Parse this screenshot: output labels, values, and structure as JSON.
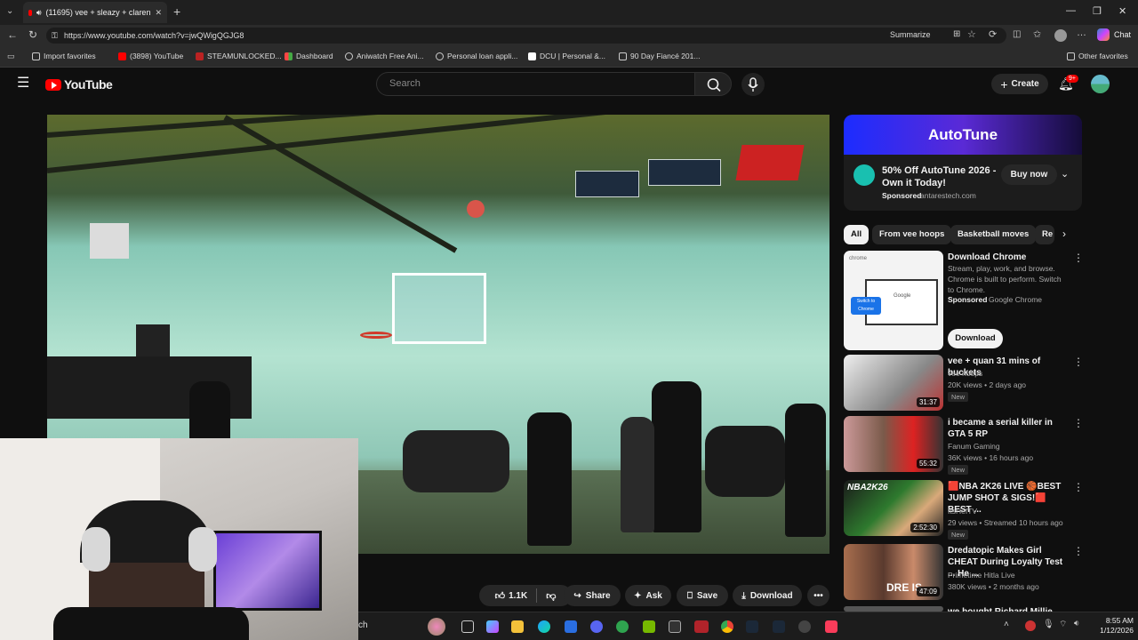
{
  "browser": {
    "tab_title": "(11695) vee + sleazy + claren",
    "url": "https://www.youtube.com/watch?v=jwQWigQGJG8",
    "summarize_label": "Summarize",
    "chat_label": "Chat"
  },
  "bookmarks": [
    {
      "label": "Import favorites"
    },
    {
      "label": "(3898) YouTube"
    },
    {
      "label": "STEAMUNLOCKED..."
    },
    {
      "label": "Dashboard"
    },
    {
      "label": "Aniwatch Free Ani..."
    },
    {
      "label": "Personal loan appli..."
    },
    {
      "label": "DCU | Personal &..."
    },
    {
      "label": "90 Day Fiancé 201..."
    },
    {
      "label": "Other favorites"
    }
  ],
  "youtube": {
    "logo_text": "YouTube",
    "search_placeholder": "Search",
    "create_label": "Create",
    "notif_count": "9+"
  },
  "actions": {
    "like_count": "1.1K",
    "share": "Share",
    "ask": "Ask",
    "save": "Save",
    "download": "Download"
  },
  "ad": {
    "banner": "AutoTune",
    "title": "50% Off AutoTune 2026 - Own it Today!",
    "sponsored": "Sponsored",
    "domain": "antarestech.com",
    "cta": "Buy now"
  },
  "chips": [
    {
      "label": "All"
    },
    {
      "label": "From vee hoops"
    },
    {
      "label": "Basketball moves"
    },
    {
      "label": "Re"
    }
  ],
  "chrome_ad": {
    "title": "Download Chrome",
    "desc": "Stream, play, work, and browse. Chrome is built to perform. Switch to Chrome.",
    "sponsored": "Sponsored",
    "advertiser": "Google Chrome",
    "cta": "Download",
    "thumb_brand": "Google",
    "thumb_button": "Switch to Chrome",
    "thumb_logo": "chrome"
  },
  "videos": [
    {
      "title": "vee + quan 31 mins of buckets",
      "channel": "vee hoops",
      "meta": "20K views • 2 days ago",
      "badge": "New",
      "duration": "31:37"
    },
    {
      "title": "i became a serial killer in GTA 5 RP",
      "channel": "Fanum Gaming",
      "meta": "36K views • 16 hours ago",
      "badge": "New",
      "duration": "55:32"
    },
    {
      "title": "🟥NBA 2K26 LIVE 🏀BEST JUMP SHOT & SIGS!🟥 BEST ...",
      "channel": "ItsHefTV",
      "meta": "29 views • Streamed 10 hours ago",
      "badge": "New",
      "duration": "2:52:30",
      "thumb_text": "NBA2K26"
    },
    {
      "title": "Dredatopic Makes Girl CHEAT During Loyalty Test ... He ...",
      "channel": "Primetime Hitla Live",
      "meta": "380K views • 2 months ago",
      "badge": "",
      "duration": "47:09",
      "thumb_text": "DRE IS"
    },
    {
      "title": "we bought Richard Millie in...",
      "channel": "",
      "meta": "",
      "badge": "",
      "duration": ""
    }
  ],
  "taskbar": {
    "search_text": "ch",
    "time": "8:55 AM",
    "date": "1/12/2026"
  },
  "colors": {
    "yt_red": "#ff0000",
    "bg": "#0f0f0f",
    "ad_gradient_start": "#1c2cff"
  }
}
